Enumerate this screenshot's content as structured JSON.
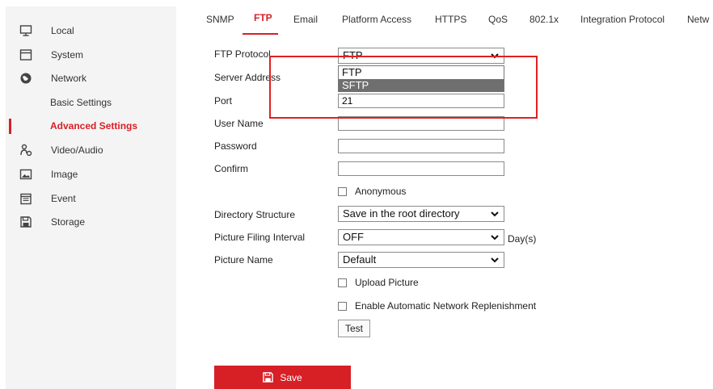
{
  "colors": {
    "accent": "#d71f26",
    "sidebar_bg": "#f4f4f4",
    "annotation": "#e02020"
  },
  "sidebar": {
    "items": [
      {
        "label": "Local",
        "icon": "monitor-icon"
      },
      {
        "label": "System",
        "icon": "window-icon"
      },
      {
        "label": "Network",
        "icon": "globe-icon"
      },
      {
        "label": "Basic Settings"
      },
      {
        "label": "Advanced Settings",
        "active": true
      },
      {
        "label": "Video/Audio",
        "icon": "camera-icon"
      },
      {
        "label": "Image",
        "icon": "image-icon"
      },
      {
        "label": "Event",
        "icon": "calendar-icon"
      },
      {
        "label": "Storage",
        "icon": "floppy-icon"
      }
    ]
  },
  "tabs": [
    {
      "label": "SNMP"
    },
    {
      "label": "FTP",
      "active": true
    },
    {
      "label": "Email"
    },
    {
      "label": "Platform Access"
    },
    {
      "label": "HTTPS"
    },
    {
      "label": "QoS"
    },
    {
      "label": "802.1x"
    },
    {
      "label": "Integration Protocol"
    },
    {
      "label": "Netw"
    }
  ],
  "form": {
    "ftp_protocol": {
      "label": "FTP Protocol",
      "value": "FTP",
      "options": [
        "FTP",
        "SFTP"
      ],
      "highlighted": "SFTP"
    },
    "server_address": {
      "label": "Server Address",
      "value": ""
    },
    "port": {
      "label": "Port",
      "value": "21"
    },
    "user_name": {
      "label": "User Name",
      "value": ""
    },
    "password": {
      "label": "Password",
      "value": ""
    },
    "confirm": {
      "label": "Confirm",
      "value": ""
    },
    "anonymous": {
      "label": "Anonymous",
      "checked": false
    },
    "directory_structure": {
      "label": "Directory Structure",
      "value": "Save in the root directory"
    },
    "picture_filing_interval": {
      "label": "Picture Filing Interval",
      "value": "OFF",
      "unit": "Day(s)"
    },
    "picture_name": {
      "label": "Picture Name",
      "value": "Default"
    },
    "upload_picture": {
      "label": "Upload Picture",
      "checked": false
    },
    "enable_anr": {
      "label": "Enable Automatic Network Replenishment",
      "checked": false
    },
    "test_label": "Test",
    "save_label": "Save"
  }
}
